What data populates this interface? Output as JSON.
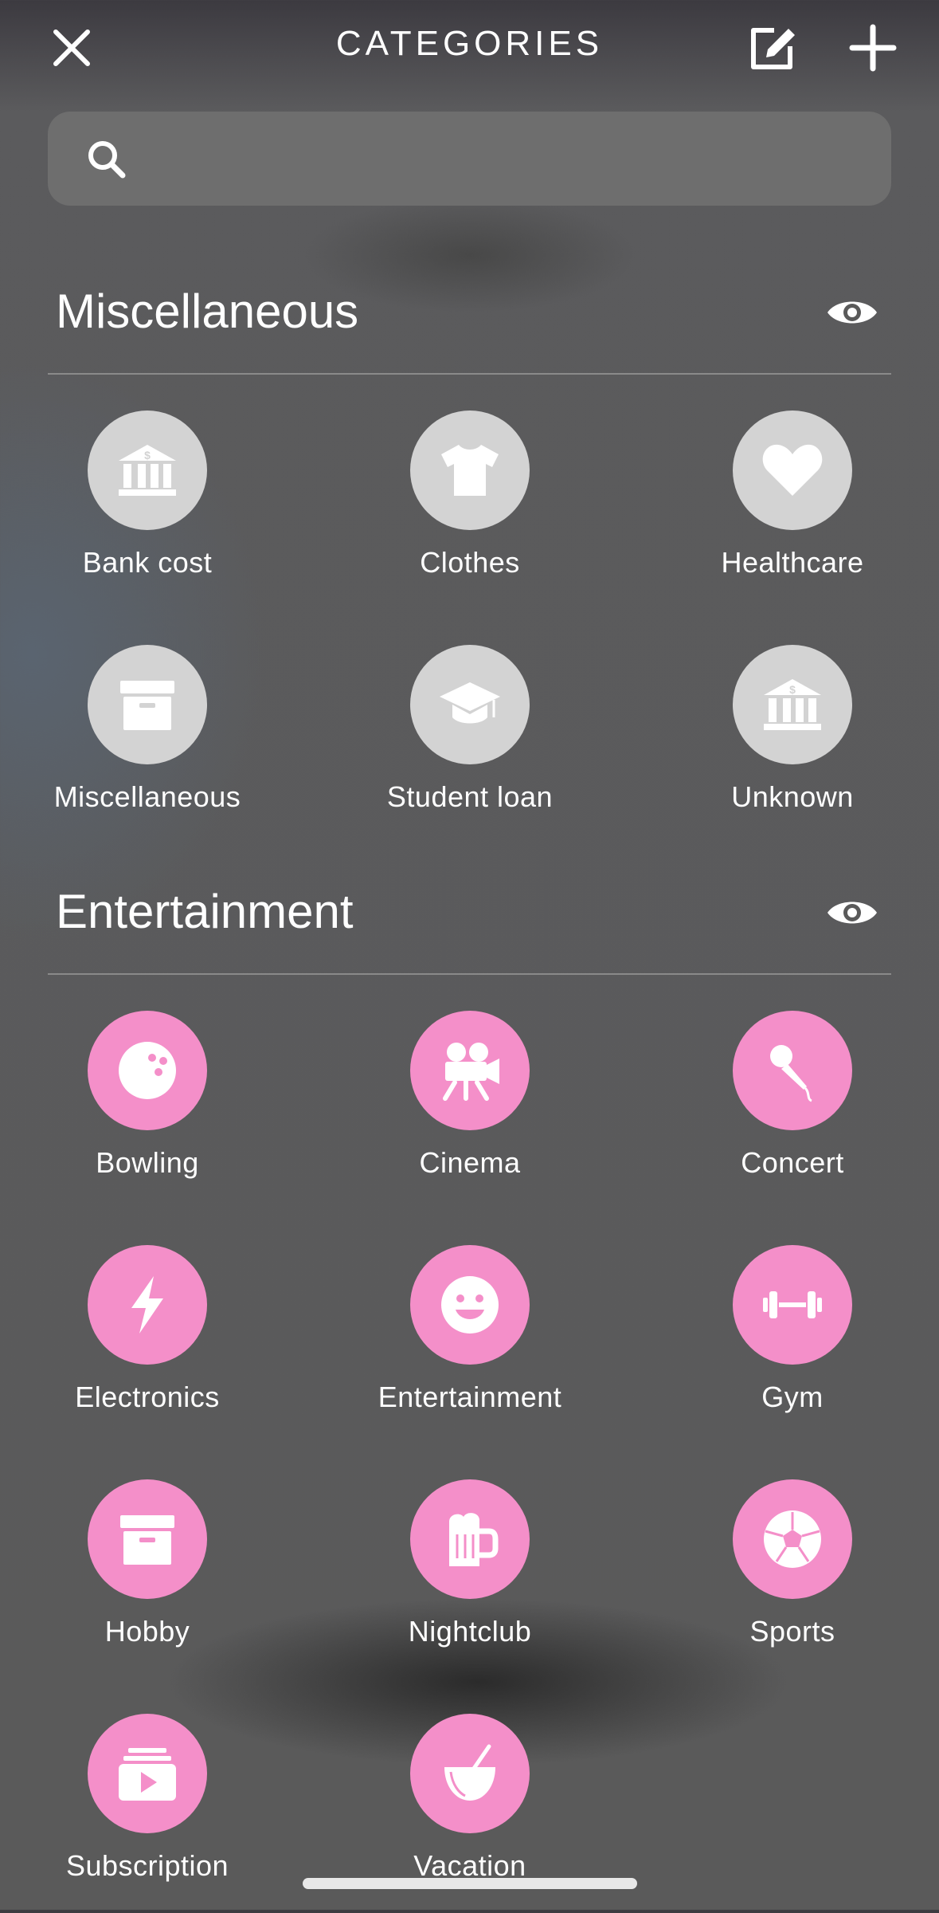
{
  "header": {
    "title": "CATEGORIES",
    "close_icon": "close-icon",
    "edit_icon": "edit-icon",
    "add_icon": "plus-icon"
  },
  "search": {
    "placeholder": ""
  },
  "sections": [
    {
      "title": "Miscellaneous",
      "visibility_icon": "eye-icon",
      "color": "#d3d3d3",
      "items": [
        {
          "label": "Bank cost",
          "icon": "bank-icon"
        },
        {
          "label": "Clothes",
          "icon": "tshirt-icon"
        },
        {
          "label": "Healthcare",
          "icon": "heart-icon"
        },
        {
          "label": "Miscellaneous",
          "icon": "archive-box-icon"
        },
        {
          "label": "Student loan",
          "icon": "graduation-cap-icon"
        },
        {
          "label": "Unknown",
          "icon": "bank-icon"
        }
      ]
    },
    {
      "title": "Entertainment",
      "visibility_icon": "eye-icon",
      "color": "#f48fc9",
      "items": [
        {
          "label": "Bowling",
          "icon": "bowling-ball-icon"
        },
        {
          "label": "Cinema",
          "icon": "film-camera-icon"
        },
        {
          "label": "Concert",
          "icon": "microphone-icon"
        },
        {
          "label": "Electronics",
          "icon": "lightning-bolt-icon"
        },
        {
          "label": "Entertainment",
          "icon": "smiley-face-icon"
        },
        {
          "label": "Gym",
          "icon": "dumbbell-icon"
        },
        {
          "label": "Hobby",
          "icon": "archive-box-icon"
        },
        {
          "label": "Nightclub",
          "icon": "beer-mug-icon"
        },
        {
          "label": "Sports",
          "icon": "soccer-ball-icon"
        },
        {
          "label": "Subscription",
          "icon": "play-button-icon"
        },
        {
          "label": "Vacation",
          "icon": "coconut-drink-icon"
        }
      ]
    }
  ]
}
